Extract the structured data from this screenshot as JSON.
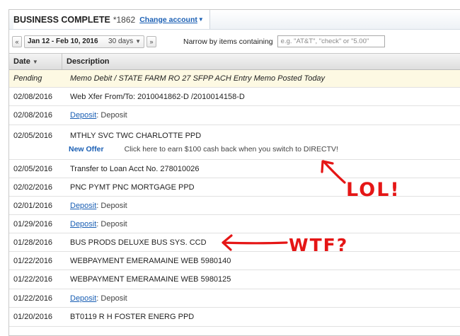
{
  "account": {
    "name": "BUSINESS COMPLETE",
    "number": "*1862",
    "change_label": "Change account"
  },
  "filter": {
    "prev_icon": "«",
    "next_icon": "»",
    "range": "Jan 12 - Feb 10, 2016",
    "days": "30 days",
    "narrow_label": "Narrow by items containing",
    "search_placeholder": "e.g. \"AT&T\", \"check\" or \"5.00\""
  },
  "table": {
    "col_date": "Date",
    "col_desc": "Description",
    "pending": {
      "date": "Pending",
      "desc": "Memo Debit / STATE FARM RO 27 SFPP ACH Entry Memo Posted Today"
    },
    "rows": [
      {
        "date": "02/08/2016",
        "desc": "Web Xfer From/To: 2010041862-D /2010014158-D"
      },
      {
        "date": "02/08/2016",
        "link": "Deposit",
        "desc": ": Deposit"
      },
      {
        "date": "02/05/2016",
        "desc": "MTHLY SVC TWC CHARLOTTE PPD",
        "offer_title": "New Offer",
        "offer_text": "Click here to earn $100 cash back when you switch to DIRECTV!"
      },
      {
        "date": "02/05/2016",
        "desc": "Transfer to Loan Acct No. 278010026"
      },
      {
        "date": "02/02/2016",
        "desc": "PNC PYMT PNC MORTGAGE PPD"
      },
      {
        "date": "02/01/2016",
        "link": "Deposit",
        "desc": ": Deposit"
      },
      {
        "date": "01/29/2016",
        "link": "Deposit",
        "desc": ": Deposit"
      },
      {
        "date": "01/28/2016",
        "desc": "BUS PRODS DELUXE BUS SYS. CCD"
      },
      {
        "date": "01/22/2016",
        "desc": "WEBPAYMENT EMERAMAINE WEB 5980140"
      },
      {
        "date": "01/22/2016",
        "desc": "WEBPAYMENT EMERAMAINE WEB 5980125"
      },
      {
        "date": "01/22/2016",
        "link": "Deposit",
        "desc": ": Deposit"
      },
      {
        "date": "01/20/2016",
        "desc": "BT0119 R H FOSTER ENERG PPD"
      }
    ]
  },
  "annotations": {
    "lol": "LOL!",
    "wtf": "WTF?",
    "color": "#e51616"
  }
}
